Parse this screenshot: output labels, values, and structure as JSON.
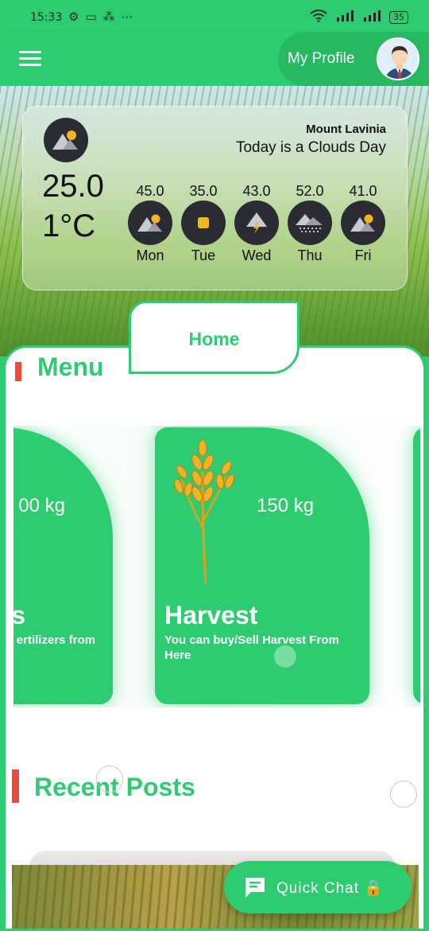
{
  "status_bar": {
    "time": "15:33",
    "battery": "35",
    "icons": [
      "gear-icon",
      "laptop-icon",
      "apps-icon",
      "more-icon"
    ],
    "right_icons": [
      "wifi-icon",
      "signal-icon",
      "signal-icon",
      "battery-icon"
    ]
  },
  "app_bar": {
    "profile_label": "My Profile",
    "menu_icon": "hamburger-icon"
  },
  "weather": {
    "location": "Mount Lavinia",
    "condition": "Today is a Clouds Day",
    "temperature": "25.01°C",
    "forecast": [
      {
        "value": "45.0",
        "day": "Mon",
        "icon": "sun-cloud-icon"
      },
      {
        "value": "35.0",
        "day": "Tue",
        "icon": "sun-icon"
      },
      {
        "value": "43.0",
        "day": "Wed",
        "icon": "thunder-icon"
      },
      {
        "value": "52.0",
        "day": "Thu",
        "icon": "snow-icon"
      },
      {
        "value": "41.0",
        "day": "Fri",
        "icon": "sun-cloud-icon"
      }
    ]
  },
  "tabs": {
    "home": "Home"
  },
  "menu": {
    "title": "Menu",
    "cards": [
      {
        "qty": "00 kg",
        "title": "s",
        "desc": "ertilizers from"
      },
      {
        "qty": "150 kg",
        "title": "Harvest",
        "desc": "You can buy/Sell Harvest From Here"
      }
    ]
  },
  "recent_posts": {
    "title": "Recent Posts"
  },
  "quick_chat": {
    "label": "Quick Chat 🔒"
  },
  "colors": {
    "primary": "#2ecc71",
    "accent": "#e74c3c"
  }
}
